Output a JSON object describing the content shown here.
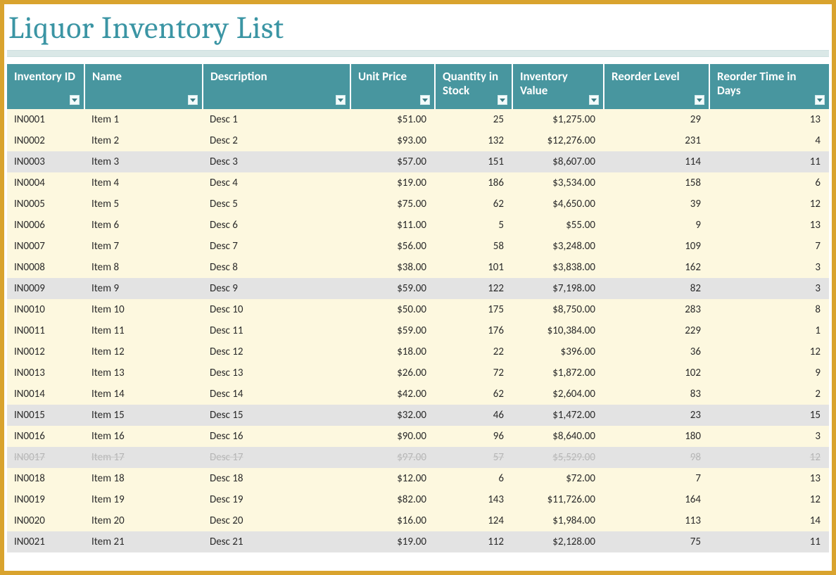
{
  "title": "Liquor Inventory List",
  "columns": [
    {
      "key": "id",
      "label": "Inventory ID",
      "align": "left"
    },
    {
      "key": "name",
      "label": "Name",
      "align": "left"
    },
    {
      "key": "desc",
      "label": "Description",
      "align": "left"
    },
    {
      "key": "price",
      "label": "Unit Price",
      "align": "right"
    },
    {
      "key": "qty",
      "label": "Quantity in Stock",
      "align": "right"
    },
    {
      "key": "value",
      "label": "Inventory Value",
      "align": "right"
    },
    {
      "key": "reorder",
      "label": "Reorder Level",
      "align": "right"
    },
    {
      "key": "days",
      "label": "Reorder Time in Days",
      "align": "right"
    }
  ],
  "rows": [
    {
      "id": "IN0001",
      "name": "Item 1",
      "desc": "Desc 1",
      "price": "$51.00",
      "qty": "25",
      "value": "$1,275.00",
      "reorder": "29",
      "days": "13",
      "band": "a"
    },
    {
      "id": "IN0002",
      "name": "Item 2",
      "desc": "Desc 2",
      "price": "$93.00",
      "qty": "132",
      "value": "$12,276.00",
      "reorder": "231",
      "days": "4",
      "band": "a"
    },
    {
      "id": "IN0003",
      "name": "Item 3",
      "desc": "Desc 3",
      "price": "$57.00",
      "qty": "151",
      "value": "$8,607.00",
      "reorder": "114",
      "days": "11",
      "band": "b"
    },
    {
      "id": "IN0004",
      "name": "Item 4",
      "desc": "Desc 4",
      "price": "$19.00",
      "qty": "186",
      "value": "$3,534.00",
      "reorder": "158",
      "days": "6",
      "band": "a"
    },
    {
      "id": "IN0005",
      "name": "Item 5",
      "desc": "Desc 5",
      "price": "$75.00",
      "qty": "62",
      "value": "$4,650.00",
      "reorder": "39",
      "days": "12",
      "band": "a"
    },
    {
      "id": "IN0006",
      "name": "Item 6",
      "desc": "Desc 6",
      "price": "$11.00",
      "qty": "5",
      "value": "$55.00",
      "reorder": "9",
      "days": "13",
      "band": "a"
    },
    {
      "id": "IN0007",
      "name": "Item 7",
      "desc": "Desc 7",
      "price": "$56.00",
      "qty": "58",
      "value": "$3,248.00",
      "reorder": "109",
      "days": "7",
      "band": "a"
    },
    {
      "id": "IN0008",
      "name": "Item 8",
      "desc": "Desc 8",
      "price": "$38.00",
      "qty": "101",
      "value": "$3,838.00",
      "reorder": "162",
      "days": "3",
      "band": "a"
    },
    {
      "id": "IN0009",
      "name": "Item 9",
      "desc": "Desc 9",
      "price": "$59.00",
      "qty": "122",
      "value": "$7,198.00",
      "reorder": "82",
      "days": "3",
      "band": "b"
    },
    {
      "id": "IN0010",
      "name": "Item 10",
      "desc": "Desc 10",
      "price": "$50.00",
      "qty": "175",
      "value": "$8,750.00",
      "reorder": "283",
      "days": "8",
      "band": "a"
    },
    {
      "id": "IN0011",
      "name": "Item 11",
      "desc": "Desc 11",
      "price": "$59.00",
      "qty": "176",
      "value": "$10,384.00",
      "reorder": "229",
      "days": "1",
      "band": "a"
    },
    {
      "id": "IN0012",
      "name": "Item 12",
      "desc": "Desc 12",
      "price": "$18.00",
      "qty": "22",
      "value": "$396.00",
      "reorder": "36",
      "days": "12",
      "band": "a"
    },
    {
      "id": "IN0013",
      "name": "Item 13",
      "desc": "Desc 13",
      "price": "$26.00",
      "qty": "72",
      "value": "$1,872.00",
      "reorder": "102",
      "days": "9",
      "band": "a"
    },
    {
      "id": "IN0014",
      "name": "Item 14",
      "desc": "Desc 14",
      "price": "$42.00",
      "qty": "62",
      "value": "$2,604.00",
      "reorder": "83",
      "days": "2",
      "band": "a"
    },
    {
      "id": "IN0015",
      "name": "Item 15",
      "desc": "Desc 15",
      "price": "$32.00",
      "qty": "46",
      "value": "$1,472.00",
      "reorder": "23",
      "days": "15",
      "band": "b"
    },
    {
      "id": "IN0016",
      "name": "Item 16",
      "desc": "Desc 16",
      "price": "$90.00",
      "qty": "96",
      "value": "$8,640.00",
      "reorder": "180",
      "days": "3",
      "band": "a"
    },
    {
      "id": "IN0017",
      "name": "Item 17",
      "desc": "Desc 17",
      "price": "$97.00",
      "qty": "57",
      "value": "$5,529.00",
      "reorder": "98",
      "days": "12",
      "band": "faded"
    },
    {
      "id": "IN0018",
      "name": "Item 18",
      "desc": "Desc 18",
      "price": "$12.00",
      "qty": "6",
      "value": "$72.00",
      "reorder": "7",
      "days": "13",
      "band": "a"
    },
    {
      "id": "IN0019",
      "name": "Item 19",
      "desc": "Desc 19",
      "price": "$82.00",
      "qty": "143",
      "value": "$11,726.00",
      "reorder": "164",
      "days": "12",
      "band": "a"
    },
    {
      "id": "IN0020",
      "name": "Item 20",
      "desc": "Desc 20",
      "price": "$16.00",
      "qty": "124",
      "value": "$1,984.00",
      "reorder": "113",
      "days": "14",
      "band": "a"
    },
    {
      "id": "IN0021",
      "name": "Item 21",
      "desc": "Desc 21",
      "price": "$19.00",
      "qty": "112",
      "value": "$2,128.00",
      "reorder": "75",
      "days": "11",
      "band": "b"
    }
  ]
}
